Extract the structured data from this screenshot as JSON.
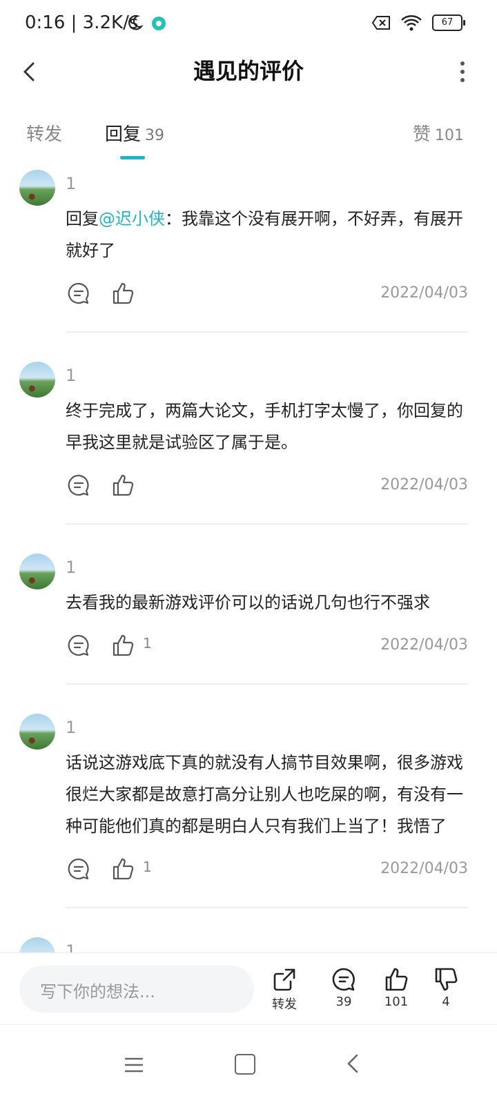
{
  "status_bar": {
    "time": "0:16 | 3.2K/s",
    "battery": "67",
    "dot_color": "#22c3b4"
  },
  "header": {
    "title": "遇见的评价"
  },
  "tabs": {
    "repost": "转发",
    "reply": "回复",
    "reply_count": "39",
    "likes": "赞",
    "likes_count": "101",
    "accent_color": "#22b4c4"
  },
  "comments": [
    {
      "name": "1",
      "reply_prefix": "回复",
      "mention": "@迟小侠",
      "text": "：我靠这个没有展开啊，不好弄，有展开就好了",
      "likes": "",
      "date": "2022/04/03"
    },
    {
      "name": "1",
      "reply_prefix": "",
      "mention": "",
      "text": "终于完成了，两篇大论文，手机打字太慢了，你回复的早我这里就是试验区了属于是。",
      "likes": "",
      "date": "2022/04/03"
    },
    {
      "name": "1",
      "reply_prefix": "",
      "mention": "",
      "text": "去看我的最新游戏评价可以的话说几句也行不强求",
      "likes": "1",
      "date": "2022/04/03"
    },
    {
      "name": "1",
      "reply_prefix": "",
      "mention": "",
      "text": "话说这游戏底下真的就没有人搞节目效果啊，很多游戏很烂大家都是故意打高分让别人也吃屎的啊，有没有一种可能他们真的都是明白人只有我们上当了！我悟了",
      "likes": "1",
      "date": "2022/04/03"
    },
    {
      "name": "1",
      "reply_prefix": "",
      "mention": "",
      "text": "",
      "likes": "",
      "date": ""
    }
  ],
  "bottom_bar": {
    "placeholder": "写下你的想法...",
    "repost_label": "转发",
    "comments": "39",
    "likes": "101",
    "dislikes": "4"
  },
  "icons": [
    "back-arrow-icon",
    "more-icon",
    "comment-icon",
    "thumb-up-icon",
    "share-icon",
    "thumb-down-icon",
    "menu-icon",
    "home-icon",
    "nav-back-icon"
  ]
}
